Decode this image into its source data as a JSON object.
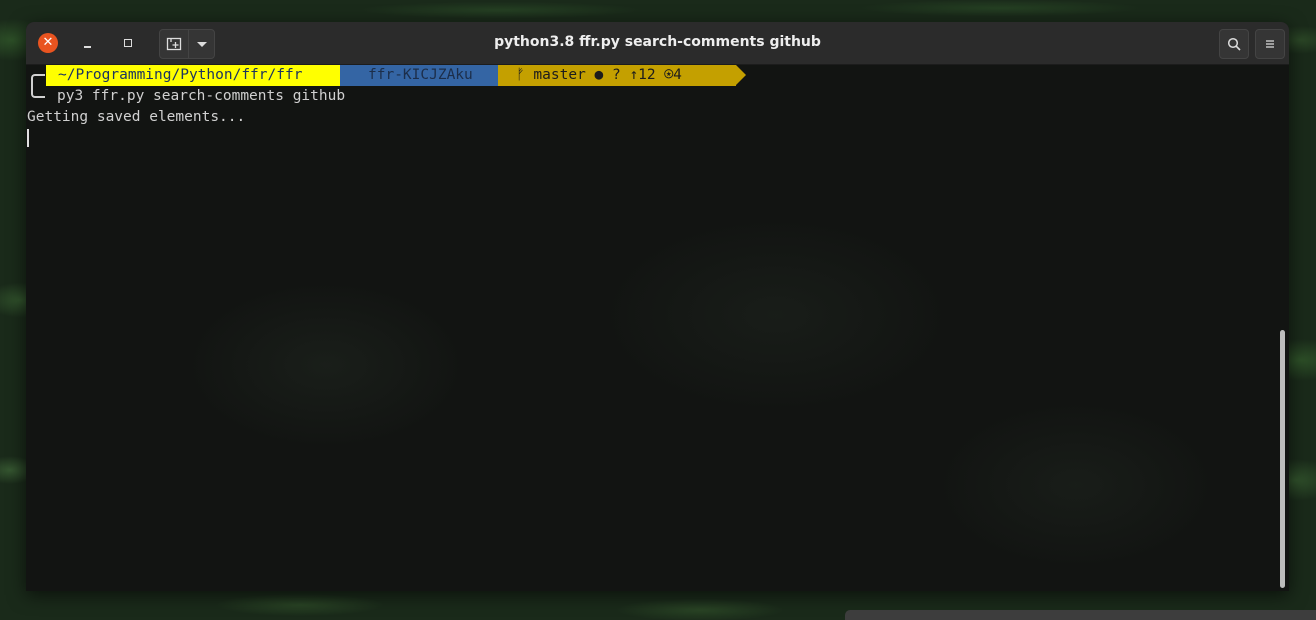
{
  "window": {
    "title": "python3.8 ffr.py search-comments github",
    "close_glyph": "✕"
  },
  "prompt": {
    "path": "~/Programming/Python/ffr/ffr",
    "venv": "ffr-KICJZAku",
    "git": "ᚠ master ● ? ↑12 ⍟4",
    "colors": {
      "path_bg": "#ffff00",
      "venv_bg": "#3465a4",
      "git_bg": "#c4a000"
    }
  },
  "command": "py3 ffr.py search-comments github",
  "output": [
    "Getting saved elements..."
  ],
  "icons": {
    "new_tab": "new-tab-icon",
    "tab_menu": "chevron-down-icon",
    "search": "search-icon",
    "menu": "hamburger-menu-icon"
  }
}
